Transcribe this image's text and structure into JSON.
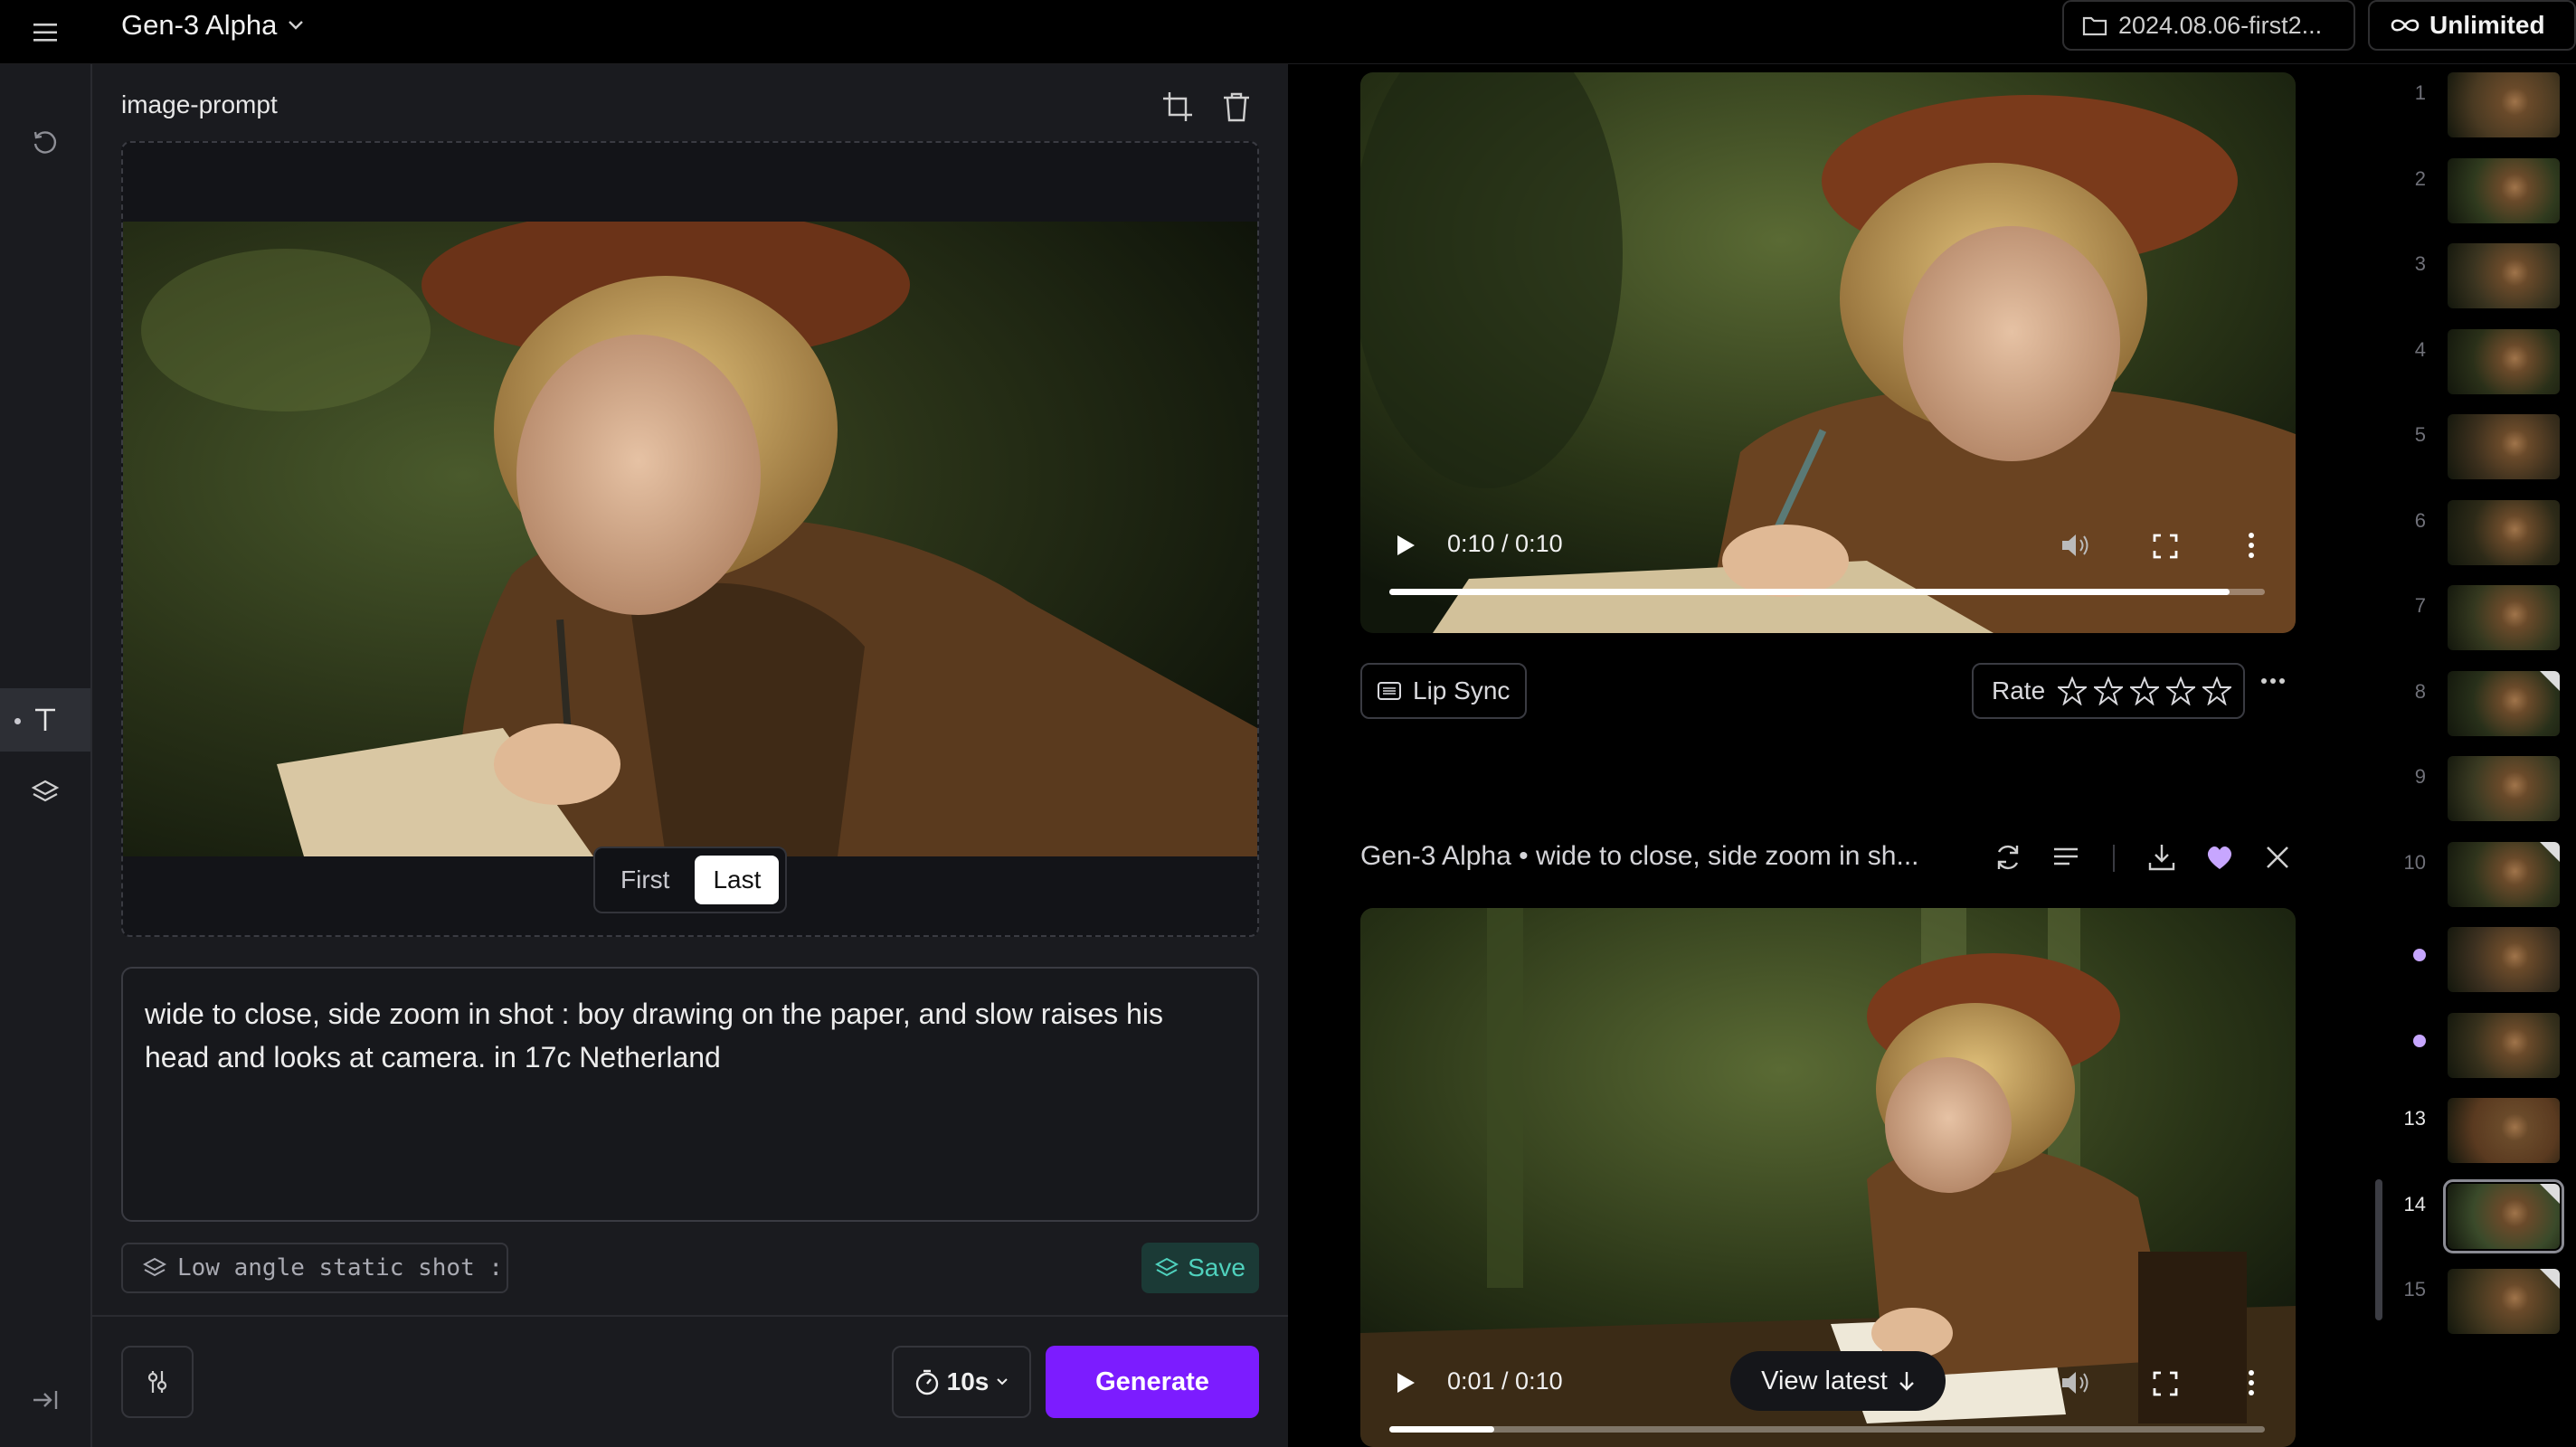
{
  "app": {
    "title": "Gen-3 Alpha",
    "folder_label": "2024.08.06-first2...",
    "plan_label": "Unlimited"
  },
  "panel": {
    "title": "image-prompt",
    "frame_toggle": {
      "first": "First",
      "last": "Last",
      "selected": "Last"
    },
    "prompt_text": "wide to close, side zoom in shot : boy drawing on the paper, and slow raises his head and looks at camera. in 17c Netherland",
    "preset_label": "Low angle static shot :",
    "save_label": "Save",
    "duration_label": "10s",
    "generate_label": "Generate"
  },
  "video_top": {
    "time": "0:10 / 0:10",
    "progress": 0.96,
    "lipsync_label": "Lip Sync",
    "rate_label": "Rate",
    "stars": 5
  },
  "video_bottom": {
    "header": "Gen-3 Alpha • wide to close, side zoom in sh...",
    "time": "0:01 / 0:10",
    "progress": 0.12,
    "view_latest_label": "View latest"
  },
  "filmstrip": {
    "items": [
      {
        "label": "1"
      },
      {
        "label": "2"
      },
      {
        "label": "3"
      },
      {
        "label": "4"
      },
      {
        "label": "5"
      },
      {
        "label": "6"
      },
      {
        "label": "7"
      },
      {
        "label": "8"
      },
      {
        "label": "9"
      },
      {
        "label": "10"
      },
      {
        "label": ""
      },
      {
        "label": ""
      },
      {
        "label": "13"
      },
      {
        "label": "14"
      },
      {
        "label": "15"
      }
    ]
  },
  "colors": {
    "accent": "#7c1cff",
    "save_teal": "#4fd1bd",
    "favorite": "#c7a6ff",
    "panel_bg": "#1a1b1f"
  }
}
